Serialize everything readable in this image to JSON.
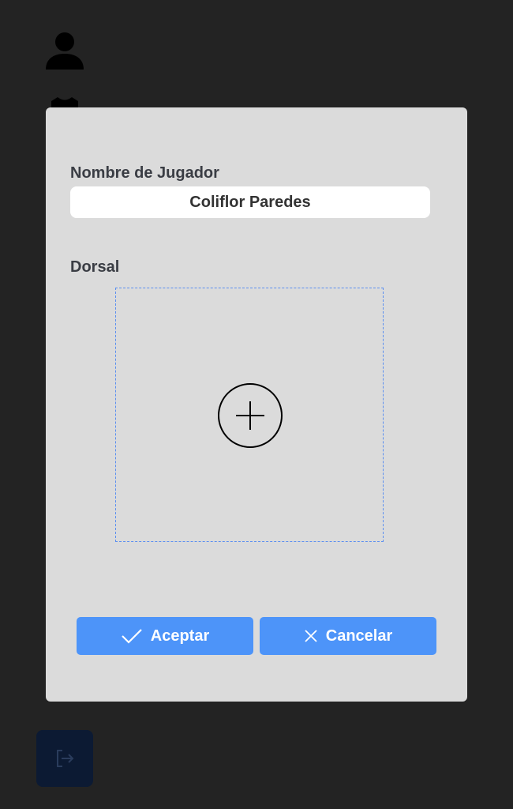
{
  "sidebar": {
    "icons": [
      "user-icon",
      "shirt-icon",
      "logout-icon"
    ]
  },
  "modal": {
    "name_label": "Nombre de Jugador",
    "name_value": "Coliflor Paredes",
    "dorsal_label": "Dorsal",
    "dropzone_icon": "add-circle-icon",
    "accept_label": "Aceptar",
    "cancel_label": "Cancelar"
  },
  "colors": {
    "background": "#232323",
    "modal_bg": "#dbdbdb",
    "accent": "#4d94f9",
    "dashed_border": "#5b8ff0",
    "logout_bg": "#0c1a33"
  }
}
